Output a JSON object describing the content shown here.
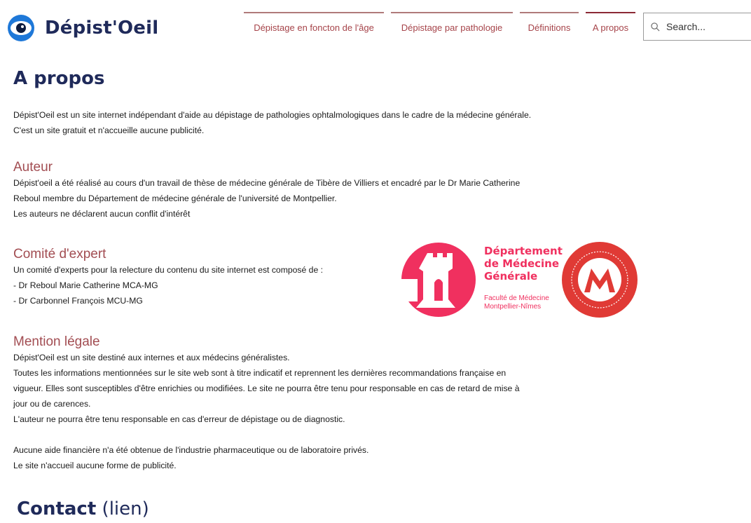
{
  "header": {
    "site_name": "Dépist'Oeil",
    "nav": [
      {
        "label": "Dépistage en foncton de l'âge",
        "active": false
      },
      {
        "label": "Dépistage par pathologie",
        "active": false
      },
      {
        "label": "Définitions",
        "active": false
      },
      {
        "label": "A propos",
        "active": true
      }
    ],
    "search_placeholder": "Search..."
  },
  "page": {
    "title": "A propos",
    "intro": [
      "Dépist'Oeil est un site internet indépendant d'aide au dépistage de pathologies ophtalmologiques dans le cadre de la médecine générale.",
      "C'est un site gratuit et n'accueille aucune publicité."
    ],
    "auteur": {
      "heading": "Auteur",
      "lines": [
        "Dépist'oeil a été réalisé au cours d'un travail de thèse de médecine générale de Tibère de Villiers et encadré par le Dr Marie Catherine",
        "Reboul membre du Département de médecine générale de l'université de Montpellier.",
        "Les auteurs ne déclarent aucun conflit d'intérêt"
      ]
    },
    "comite": {
      "heading": "Comité d'expert",
      "lines": [
        "Un comité d'experts pour la relecture du contenu du site internet est composé de :",
        "- Dr Reboul Marie Catherine MCA-MG",
        "- Dr Carbonnel François MCU-MG"
      ]
    },
    "logo_department": {
      "title_lines": [
        "Département",
        "de Médecine",
        "Générale"
      ],
      "sub_lines": [
        "Faculté de Médecine",
        "Montpellier-Nîmes"
      ]
    },
    "mention": {
      "heading": "Mention légale",
      "lines": [
        "Dépist'Oeil est un site destiné aux internes et aux médecins généralistes.",
        "Toutes les informations mentionnées sur le site web sont à titre indicatif et reprennent les dernières recommandations française en",
        "vigueur. Elles sont susceptibles d'être enrichies ou modifiées. Le site ne pourra être tenu pour responsable en cas de retard de mise à",
        "jour ou de carences.",
        "L'auteur ne pourra être tenu responsable en cas d'erreur de dépistage ou de diagnostic.",
        "",
        "Aucune aide financière n'a été obtenue de l'industrie pharmaceutique ou de laboratoire privés.",
        "Le site n'accueil aucune forme de publicité."
      ]
    },
    "contact": {
      "heading": "Contact",
      "link_text": "(lien)"
    }
  },
  "colors": {
    "navy": "#1f2a5a",
    "heading_red": "#a24d52",
    "nav_red": "#a6444a",
    "logo_pink": "#f0305f",
    "seal_red": "#e03a35",
    "eye_blue": "#1e78d8"
  }
}
